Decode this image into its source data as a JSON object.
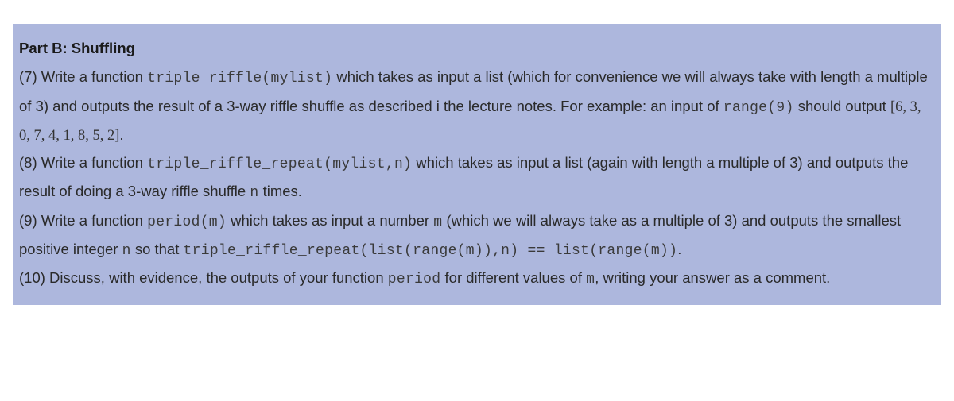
{
  "heading": "Part B: Shuffling",
  "q7": {
    "prefix": "(7) Write a function ",
    "code1": "triple_riffle(mylist)",
    "mid1": " which takes as input a list (which for convenience we will always take with length a multiple of 3) and outputs the result of a 3-way riffle shuffle as described i the lecture notes. For example: an input of ",
    "code2": "range(9)",
    "mid2": " should output ",
    "math1": "[6, 3, 0, 7, 4, 1, 8, 5, 2]",
    "suffix": "."
  },
  "q8": {
    "prefix": "(8) Write a function ",
    "code1": "triple_riffle_repeat(mylist,n)",
    "mid1": " which takes as input a list (again with length a multiple of 3) and outputs the result of doing a 3-way riffle shuffle ",
    "code2": "n",
    "suffix": " times."
  },
  "q9": {
    "prefix": "(9) Write a function ",
    "code1": "period(m)",
    "mid1": " which takes as input a number ",
    "code2": "m",
    "mid2": " (which we will always take as a multiple of 3) and outputs the smallest positive integer ",
    "code3": "n",
    "mid3": " so that ",
    "code4": "triple_riffle_repeat(list(range(m)),n) == list(range(m))",
    "suffix": "."
  },
  "q10": {
    "prefix": "(10) Discuss, with evidence, the outputs of your function ",
    "code1": "period",
    "mid1": " for different values of ",
    "code2": "m",
    "suffix": ", writing your answer as a comment."
  }
}
